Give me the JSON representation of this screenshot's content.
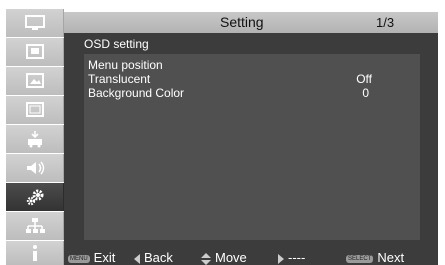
{
  "header": {
    "title": "Setting",
    "page": "1/3"
  },
  "section": {
    "title": "OSD setting"
  },
  "settings": [
    {
      "label": "Menu position",
      "value": ""
    },
    {
      "label": "Translucent",
      "value": "Off"
    },
    {
      "label": "Background Color",
      "value": "0"
    }
  ],
  "sidebar": {
    "icons": [
      "display-icon",
      "image-adjust-icon",
      "picture-icon",
      "screen-icon",
      "install-icon",
      "audio-icon",
      "settings-gears-icon",
      "network-icon",
      "info-icon"
    ],
    "active_index": 6
  },
  "bottom": {
    "exit_key": "MENU",
    "exit_label": "Exit",
    "back_label": "Back",
    "move_label": "Move",
    "next_placeholder": "----",
    "select_key": "SELECT",
    "next_label": "Next"
  },
  "colors": {
    "panel": "#3c3c3c",
    "list": "#505050",
    "header": "#c0c0c0",
    "sidebar_active": "#404040"
  }
}
